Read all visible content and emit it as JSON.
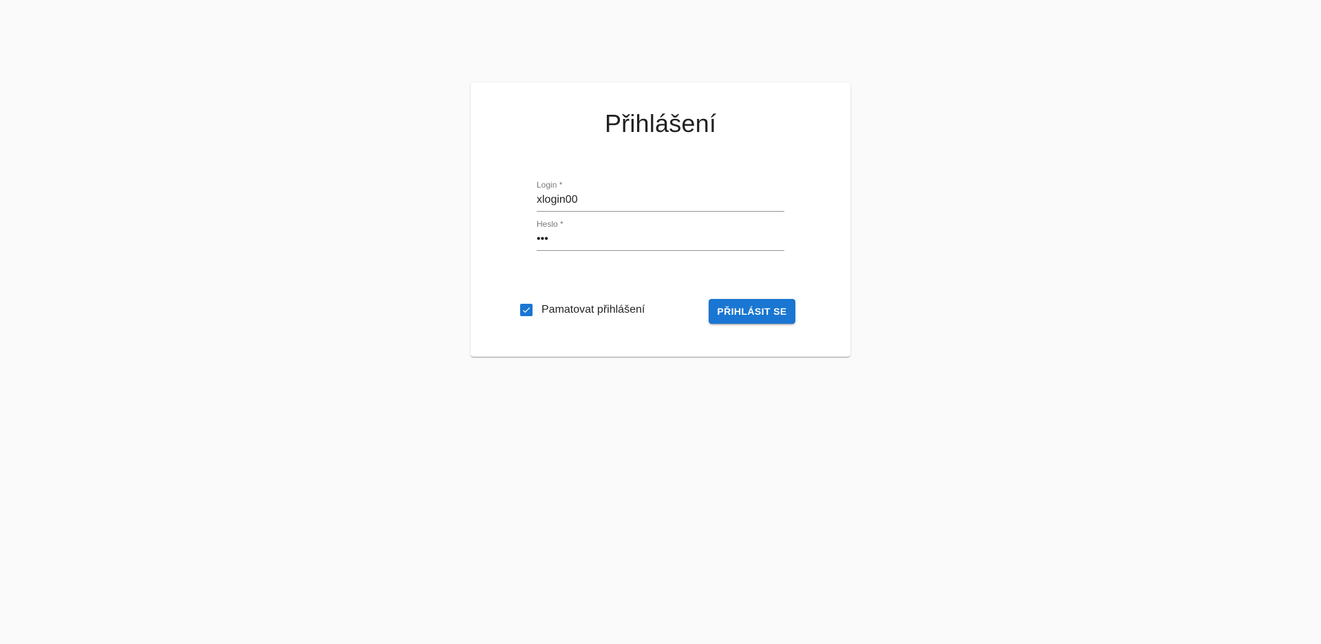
{
  "login_form": {
    "title": "Přihlášení",
    "login_field": {
      "label": "Login *",
      "value": "xlogin00"
    },
    "password_field": {
      "label": "Heslo *",
      "value": "•••"
    },
    "remember_me": {
      "label": "Pamatovat přihlášení",
      "checked": true
    },
    "submit_label": "Přihlásit se"
  },
  "colors": {
    "accent": "#1976d2",
    "background": "#fafafa",
    "card": "#ffffff"
  },
  "icons": {
    "checkbox": "check-icon"
  }
}
